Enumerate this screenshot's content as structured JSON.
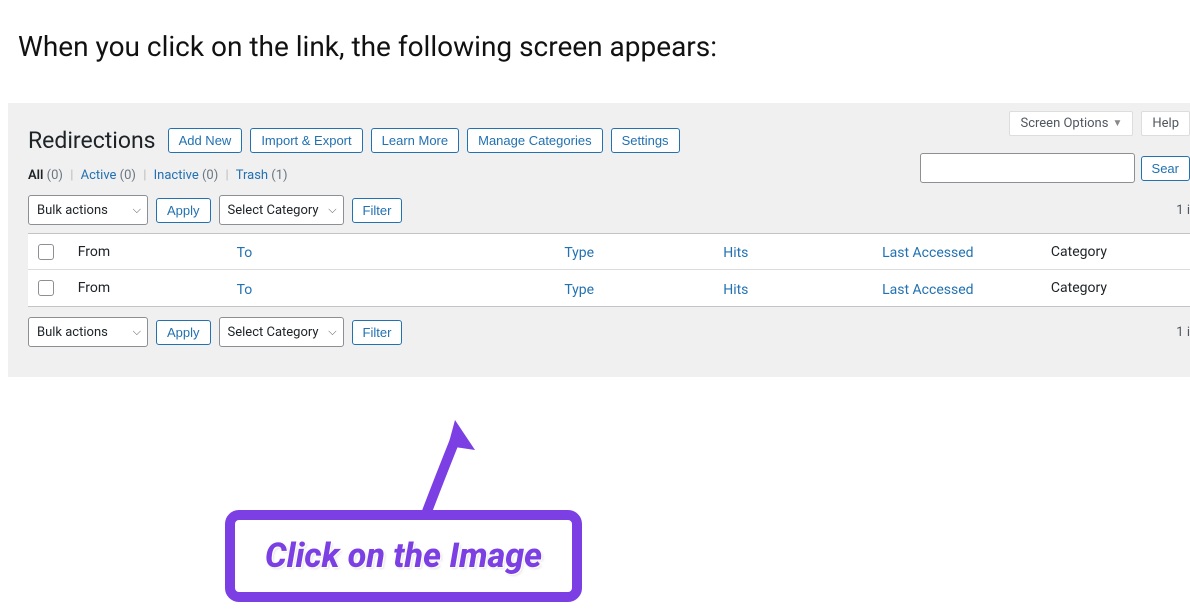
{
  "intro": "When you click on the link, the following screen appears:",
  "top_right": {
    "screen_options": "Screen Options",
    "help": "Help"
  },
  "page_title": "Redirections",
  "header_buttons": {
    "add_new": "Add New",
    "import_export": "Import & Export",
    "learn_more": "Learn More",
    "manage_categories": "Manage Categories",
    "settings": "Settings"
  },
  "filters": {
    "all_label": "All",
    "all_count": "(0)",
    "active_label": "Active",
    "active_count": "(0)",
    "inactive_label": "Inactive",
    "inactive_count": "(0)",
    "trash_label": "Trash",
    "trash_count": "(1)"
  },
  "search_button": "Sear",
  "bulk_actions": "Bulk actions",
  "apply": "Apply",
  "select_category": "Select Category",
  "filter": "Filter",
  "item_count": "1 i",
  "columns": {
    "from": "From",
    "to": "To",
    "type": "Type",
    "hits": "Hits",
    "last_accessed": "Last Accessed",
    "category": "Category"
  },
  "callout": "Click on the Image",
  "colors": {
    "link": "#2271b1",
    "accent": "#7b3fe4"
  }
}
